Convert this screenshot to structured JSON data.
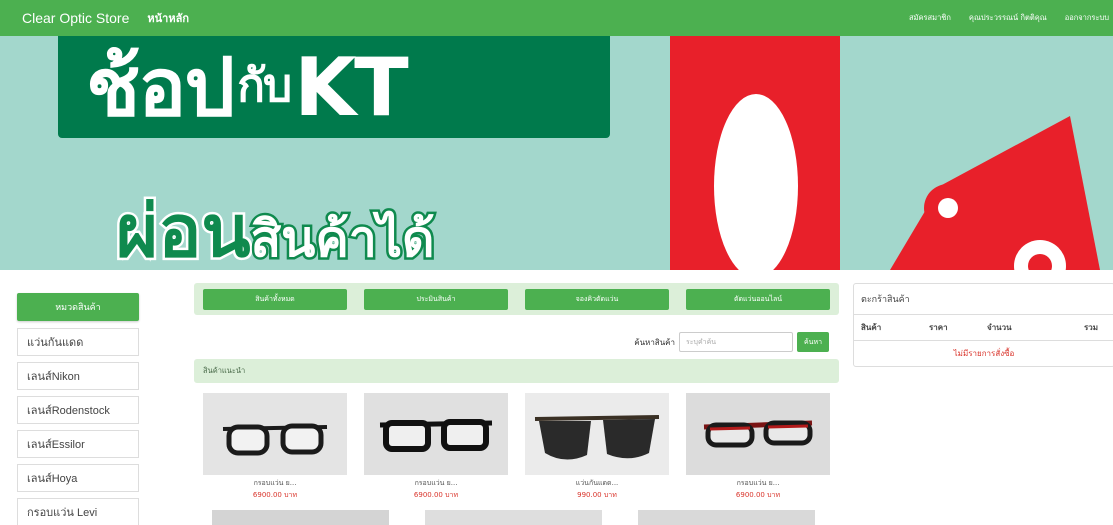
{
  "nav": {
    "brand": "Clear Optic Store",
    "home": "หน้าหลัก",
    "register": "สมัครสมาชิก",
    "greeting": "คุณประวรรณน์ กิตติคุณ",
    "logout": "ออกจากระบบ"
  },
  "banner": {
    "line1_a": "ช้อป",
    "line1_b": "กับ",
    "line1_c": "KT",
    "line2_a": "ผ่อน",
    "line2_b": "สินค้าได้",
    "big_zero": "0",
    "percent": "%",
    "colors": {
      "mint": "#a3d7cc",
      "green": "#007a4c",
      "red": "#e8202a"
    }
  },
  "sidebar": {
    "heading": "หมวดสินค้า",
    "items": [
      "แว่นกันแดด",
      "เลนส์Nikon",
      "เลนส์Rodenstock",
      "เลนส์Essilor",
      "เลนส์Hoya",
      "กรอบแว่น Levi"
    ]
  },
  "tabs": [
    "สินค้าทั้งหมด",
    "ประมินสินค้า",
    "จองคิวตัดแว่น",
    "ตัดแว่นออนไลน์"
  ],
  "search": {
    "label": "ค้นหาสินค้า",
    "placeholder": "ระบุคำค้น",
    "button": "ค้นหา"
  },
  "recommended_label": "สินค้าแนะนำ",
  "products": [
    {
      "name": "กรอบแว่น ย...",
      "price": "6900.00 บาท",
      "frame_color": "#1b1b1b",
      "lens": "clear"
    },
    {
      "name": "กรอบแว่น ย...",
      "price": "6900.00 บาท",
      "frame_color": "#111111",
      "lens": "clear"
    },
    {
      "name": "แว่นกันแดด...",
      "price": "990.00 บาท",
      "frame_color": "#2a2a2a",
      "lens": "dark"
    },
    {
      "name": "กรอบแว่น ย...",
      "price": "6900.00 บาท",
      "frame_color": "#7a1414",
      "lens": "clear"
    }
  ],
  "cart": {
    "title": "ตะกร้าสินค้า",
    "columns": [
      "สินค้า",
      "ราคา",
      "จำนวน",
      "รวม"
    ],
    "empty": "ไม่มีรายการสั่งซื้อ"
  },
  "accent": "#4cb050"
}
